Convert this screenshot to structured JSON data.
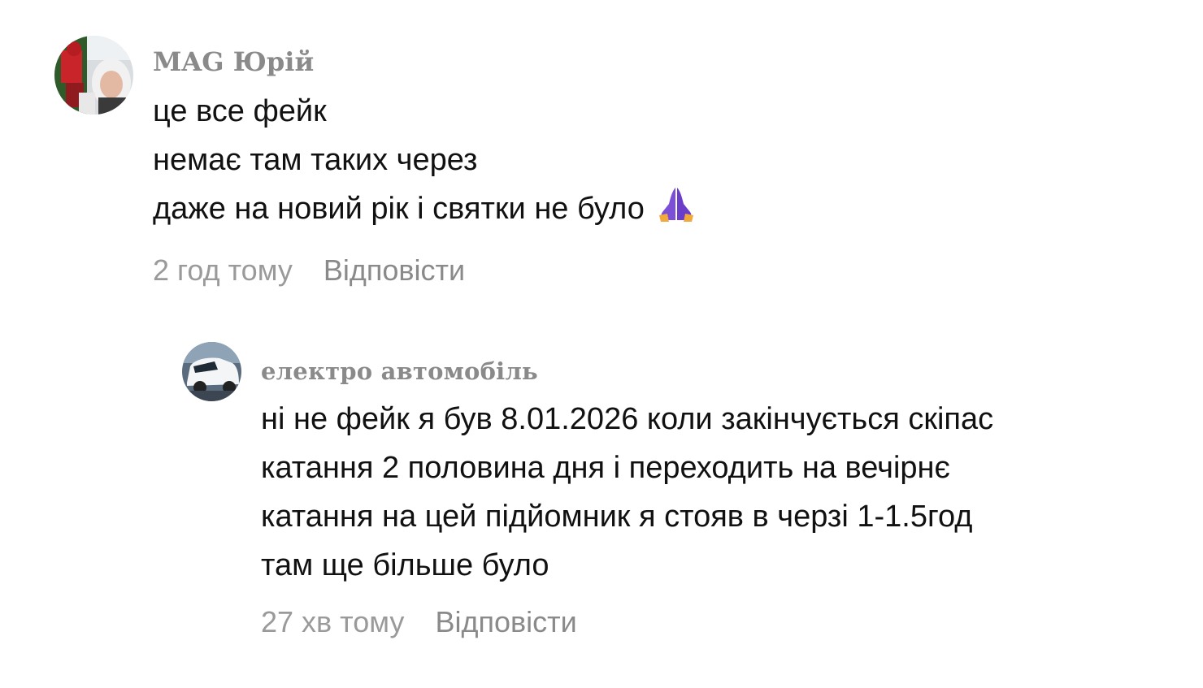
{
  "comments": [
    {
      "author": "MAG Юрій",
      "lines": [
        "це все фейк",
        "немає там таких через",
        "даже на новий рік і святки не було"
      ],
      "emoji": "praying-hands",
      "timestamp": "2 год тому",
      "reply_label": "Відповісти"
    },
    {
      "author": "електро автомобіль",
      "lines": [
        "ні не фейк я був 8.01.2026 коли закінчується скіпас",
        "катання 2 половина дня і переходить на вечірнє",
        "катання на цей підйомник я стояв в черзі 1-1.5год",
        "там ще більше було"
      ],
      "timestamp": "27 хв тому",
      "reply_label": "Відповісти"
    }
  ],
  "colors": {
    "author": "#8a8a8a",
    "text": "#111111",
    "meta": "#9a9a9a",
    "emoji": "#7b4fd6"
  }
}
